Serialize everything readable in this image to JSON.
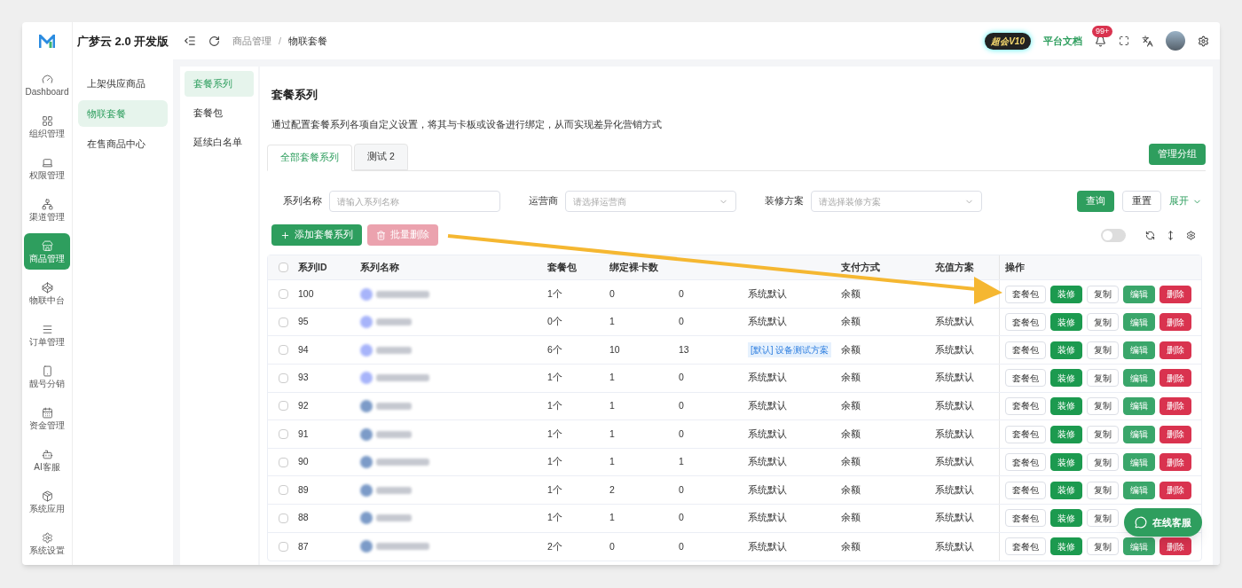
{
  "brand": {
    "name": "广梦云 2.0 开发版"
  },
  "rail": [
    {
      "label": "Dashboard",
      "selected": false
    },
    {
      "label": "组织管理",
      "selected": false
    },
    {
      "label": "权限管理",
      "selected": false
    },
    {
      "label": "渠道管理",
      "selected": false
    },
    {
      "label": "商品管理",
      "selected": true
    },
    {
      "label": "物联中台",
      "selected": false
    },
    {
      "label": "订单管理",
      "selected": false
    },
    {
      "label": "靓号分销",
      "selected": false
    },
    {
      "label": "资金管理",
      "selected": false
    },
    {
      "label": "AI客服",
      "selected": false
    },
    {
      "label": "系统应用",
      "selected": false
    },
    {
      "label": "系统设置",
      "selected": false
    }
  ],
  "submenu": [
    {
      "label": "上架供应商品",
      "selected": false
    },
    {
      "label": "物联套餐",
      "selected": true
    },
    {
      "label": "在售商品中心",
      "selected": false
    }
  ],
  "header": {
    "breadcrumb": [
      "商品管理",
      "物联套餐"
    ],
    "breadcrumb_separator": "/",
    "vip_badge": "超会V10",
    "docs_link": "平台文档",
    "notifications": "99+"
  },
  "side_tabs": [
    {
      "label": "套餐系列",
      "selected": true
    },
    {
      "label": "套餐包",
      "selected": false
    },
    {
      "label": "延续白名单",
      "selected": false
    }
  ],
  "page": {
    "title": "套餐系列",
    "description": "通过配置套餐系列各项自定义设置，将其与卡板或设备进行绑定，从而实现差异化营销方式"
  },
  "group_tabs": [
    {
      "label": "全部套餐系列",
      "selected": true
    },
    {
      "label": "测试 2",
      "selected": false
    }
  ],
  "manage_button": "管理分组",
  "filters": [
    {
      "label": "系列名称",
      "placeholder": "请输入系列名称",
      "kind": "input"
    },
    {
      "label": "运营商",
      "placeholder": "请选择运营商",
      "kind": "select"
    },
    {
      "label": "装修方案",
      "placeholder": "请选择装修方案",
      "kind": "select"
    }
  ],
  "query_button": "查询",
  "reset_button": "重置",
  "expand_link": "展开",
  "add_button": "添加套餐系列",
  "batch_delete_button": {
    "label": "批量删除",
    "disabled": true
  },
  "toggle": {
    "on": false
  },
  "table": {
    "all_checked": false,
    "columns": [
      {
        "label": "系列ID"
      },
      {
        "label": "系列名称"
      },
      {
        "label": "套餐包"
      },
      {
        "label": "绑定裸卡数"
      },
      {},
      {},
      {
        "label": "支付方式"
      },
      {
        "label": "充值方案"
      },
      {
        "label": "操作"
      }
    ],
    "rows": [
      {
        "id": "100",
        "checked": false,
        "packages": "1个",
        "bare_cards": "0",
        "devices": "0",
        "decoration": {
          "text": "系统默认",
          "tag": false
        },
        "payment": "余额",
        "actions": [
          {
            "label": "套餐包",
            "kind": "default"
          },
          {
            "label": "装修",
            "kind": "decorate"
          },
          {
            "label": "复制",
            "kind": "default"
          },
          {
            "label": "编辑",
            "kind": "edit"
          },
          {
            "label": "删除",
            "kind": "danger"
          }
        ]
      },
      {
        "id": "95",
        "checked": false,
        "packages": "0个",
        "bare_cards": "1",
        "devices": "0",
        "decoration": {
          "text": "系统默认",
          "tag": false
        },
        "payment": "余额",
        "recharge": "系统默认",
        "actions": [
          {
            "label": "套餐包",
            "kind": "default"
          },
          {
            "label": "装修",
            "kind": "decorate"
          },
          {
            "label": "复制",
            "kind": "default"
          },
          {
            "label": "编辑",
            "kind": "edit"
          },
          {
            "label": "删除",
            "kind": "danger"
          }
        ]
      },
      {
        "id": "94",
        "checked": false,
        "packages": "6个",
        "bare_cards": "10",
        "devices": "13",
        "decoration": {
          "text": "[默认] 设备测试方案",
          "tag": true
        },
        "payment": "余额",
        "recharge": "系统默认",
        "actions": [
          {
            "label": "套餐包",
            "kind": "default"
          },
          {
            "label": "装修",
            "kind": "decorate"
          },
          {
            "label": "复制",
            "kind": "default"
          },
          {
            "label": "编辑",
            "kind": "edit"
          },
          {
            "label": "删除",
            "kind": "danger"
          }
        ]
      },
      {
        "id": "93",
        "checked": false,
        "packages": "1个",
        "bare_cards": "1",
        "devices": "0",
        "decoration": {
          "text": "系统默认",
          "tag": false
        },
        "payment": "余额",
        "recharge": "系统默认",
        "actions": [
          {
            "label": "套餐包",
            "kind": "default"
          },
          {
            "label": "装修",
            "kind": "decorate"
          },
          {
            "label": "复制",
            "kind": "default"
          },
          {
            "label": "编辑",
            "kind": "edit"
          },
          {
            "label": "删除",
            "kind": "danger"
          }
        ]
      },
      {
        "id": "92",
        "checked": false,
        "packages": "1个",
        "bare_cards": "1",
        "devices": "0",
        "decoration": {
          "text": "系统默认",
          "tag": false
        },
        "payment": "余额",
        "recharge": "系统默认",
        "actions": [
          {
            "label": "套餐包",
            "kind": "default"
          },
          {
            "label": "装修",
            "kind": "decorate"
          },
          {
            "label": "复制",
            "kind": "default"
          },
          {
            "label": "编辑",
            "kind": "edit"
          },
          {
            "label": "删除",
            "kind": "danger"
          }
        ]
      },
      {
        "id": "91",
        "checked": false,
        "packages": "1个",
        "bare_cards": "1",
        "devices": "0",
        "decoration": {
          "text": "系统默认",
          "tag": false
        },
        "payment": "余额",
        "recharge": "系统默认",
        "actions": [
          {
            "label": "套餐包",
            "kind": "default"
          },
          {
            "label": "装修",
            "kind": "decorate"
          },
          {
            "label": "复制",
            "kind": "default"
          },
          {
            "label": "编辑",
            "kind": "edit"
          },
          {
            "label": "删除",
            "kind": "danger"
          }
        ]
      },
      {
        "id": "90",
        "checked": false,
        "packages": "1个",
        "bare_cards": "1",
        "devices": "1",
        "decoration": {
          "text": "系统默认",
          "tag": false
        },
        "payment": "余额",
        "recharge": "系统默认",
        "actions": [
          {
            "label": "套餐包",
            "kind": "default"
          },
          {
            "label": "装修",
            "kind": "decorate"
          },
          {
            "label": "复制",
            "kind": "default"
          },
          {
            "label": "编辑",
            "kind": "edit"
          },
          {
            "label": "删除",
            "kind": "danger"
          }
        ]
      },
      {
        "id": "89",
        "checked": false,
        "packages": "1个",
        "bare_cards": "2",
        "devices": "0",
        "decoration": {
          "text": "系统默认",
          "tag": false
        },
        "payment": "余额",
        "recharge": "系统默认",
        "actions": [
          {
            "label": "套餐包",
            "kind": "default"
          },
          {
            "label": "装修",
            "kind": "decorate"
          },
          {
            "label": "复制",
            "kind": "default"
          },
          {
            "label": "编辑",
            "kind": "edit"
          },
          {
            "label": "删除",
            "kind": "danger"
          }
        ]
      },
      {
        "id": "88",
        "checked": false,
        "packages": "1个",
        "bare_cards": "1",
        "devices": "0",
        "decoration": {
          "text": "系统默认",
          "tag": false
        },
        "payment": "余额",
        "recharge": "系统默认",
        "actions": [
          {
            "label": "套餐包",
            "kind": "default"
          },
          {
            "label": "装修",
            "kind": "decorate"
          },
          {
            "label": "复制",
            "kind": "default"
          }
        ]
      },
      {
        "id": "87",
        "checked": false,
        "packages": "2个",
        "bare_cards": "0",
        "devices": "0",
        "decoration": {
          "text": "系统默认",
          "tag": false
        },
        "payment": "余额",
        "recharge": "系统默认",
        "actions": [
          {
            "label": "套餐包",
            "kind": "default"
          },
          {
            "label": "装修",
            "kind": "decorate"
          },
          {
            "label": "复制",
            "kind": "default"
          },
          {
            "label": "编辑",
            "kind": "edit"
          },
          {
            "label": "删除",
            "kind": "danger"
          }
        ]
      }
    ]
  },
  "chat_button": "在线客服"
}
